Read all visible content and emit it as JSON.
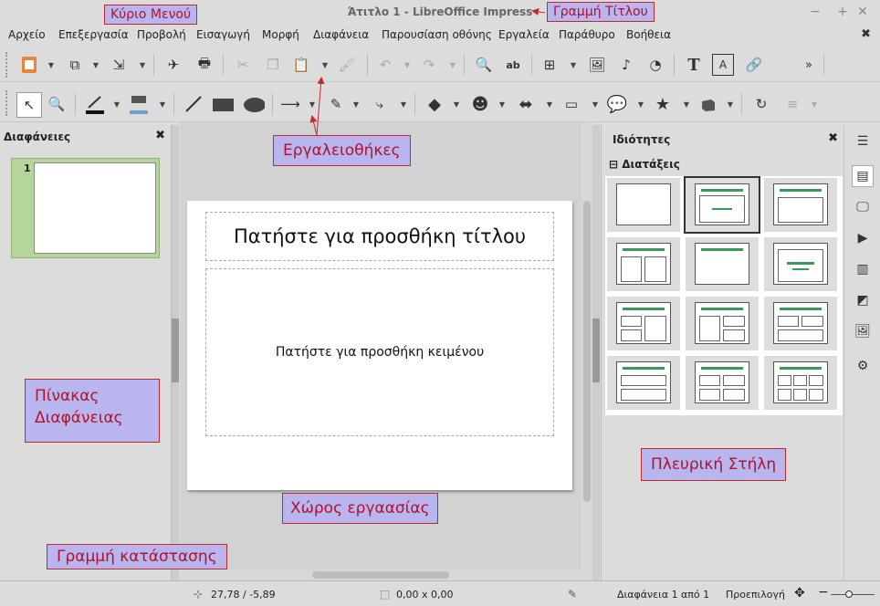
{
  "window": {
    "title": "Άτιτλο 1 - LibreOffice Impress"
  },
  "menu": [
    "Αρχείο",
    "Επεξεργασία",
    "Προβολή",
    "Εισαγωγή",
    "Μορφή",
    "Διαφάνεια",
    "Παρουσίαση οθόνης",
    "Εργαλεία",
    "Παράθυρο",
    "Βοήθεια"
  ],
  "slides_pane": {
    "header": "Διαφάνειες",
    "slide_number": "1"
  },
  "slide": {
    "title_placeholder": "Πατήστε για προσθήκη τίτλου",
    "text_placeholder": "Πατήστε για προσθήκη κειμένου"
  },
  "sidebar": {
    "header": "Ιδιότητες",
    "section": "Διατάξεις"
  },
  "status": {
    "position": "27,78 / -5,89",
    "size": "0,00 x 0,00",
    "slide_info": "Διαφάνεια 1 από 1",
    "master": "Προεπιλογή"
  },
  "annotations": {
    "menu": "Κύριο Μενού",
    "titlebar": "Γραμμή Τίτλου",
    "toolbars": "Εργαλειοθήκες",
    "slide_pane_line1": "Πίνακας",
    "slide_pane_line2": "Διαφάνειας",
    "workspace": "Χώρος εργαασίας",
    "sidebar": "Πλευρική Στήλη",
    "statusbar": "Γραμμή κατάστασης"
  }
}
